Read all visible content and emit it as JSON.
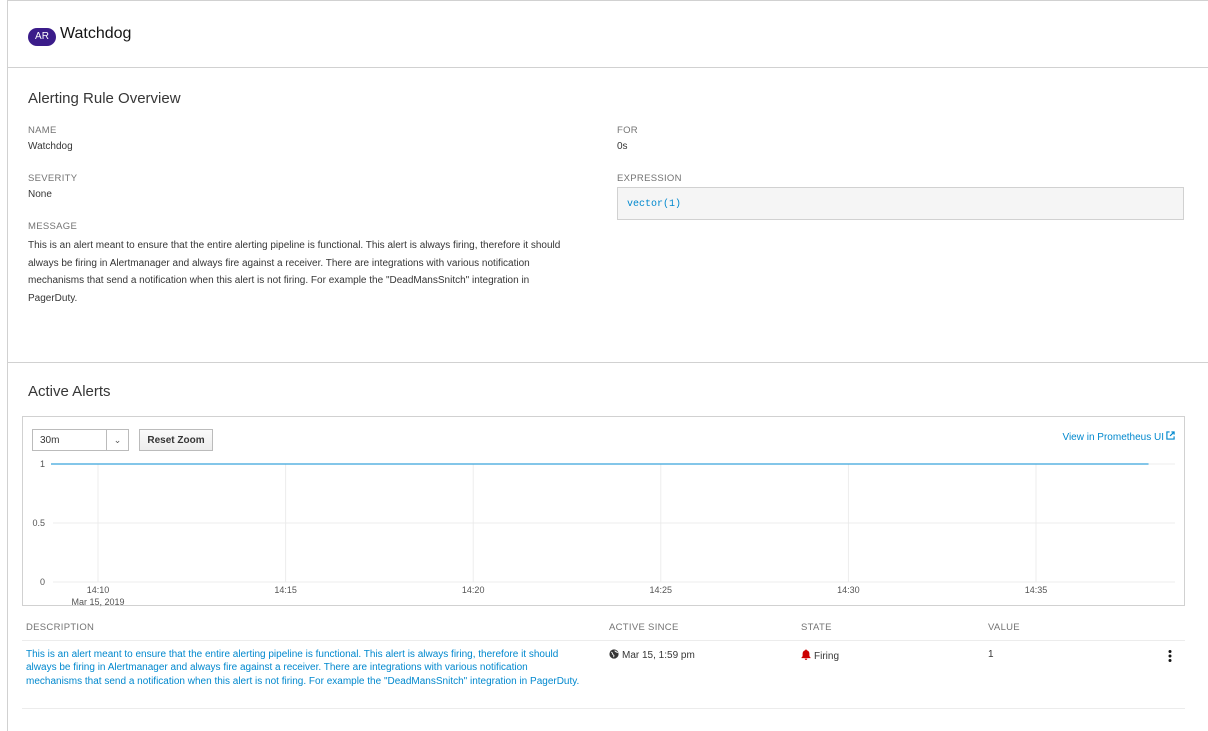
{
  "header": {
    "badge": "AR",
    "title": "Watchdog"
  },
  "overview": {
    "title": "Alerting Rule Overview",
    "name_label": "NAME",
    "name_value": "Watchdog",
    "severity_label": "SEVERITY",
    "severity_value": "None",
    "message_label": "MESSAGE",
    "message_value": "This is an alert meant to ensure that the entire alerting pipeline is functional. This alert is always firing, therefore it should always be firing in Alertmanager and always fire against a receiver. There are integrations with various notification mechanisms that send a notification when this alert is not firing. For example the \"DeadMansSnitch\" integration in PagerDuty.",
    "for_label": "FOR",
    "for_value": "0s",
    "expression_label": "EXPRESSION",
    "expression_value": "vector(1)"
  },
  "active_alerts": {
    "title": "Active Alerts",
    "range_value": "30m",
    "reset_zoom_label": "Reset Zoom",
    "prometheus_link_label": "View in Prometheus UI"
  },
  "chart_data": {
    "type": "line",
    "x_ticks": [
      "14:10",
      "14:15",
      "14:20",
      "14:25",
      "14:30",
      "14:35"
    ],
    "x_tick_sublabel": "Mar 15, 2019",
    "y_ticks": [
      "0",
      "0.5",
      "1"
    ],
    "ylim": [
      0,
      1
    ],
    "series": [
      {
        "x": [
          "14:10",
          "14:38"
        ],
        "values": [
          1,
          1
        ]
      }
    ],
    "grid": true,
    "line_color": "#39a5dc"
  },
  "table": {
    "columns": [
      "DESCRIPTION",
      "ACTIVE SINCE",
      "STATE",
      "VALUE"
    ],
    "rows": [
      {
        "description": "This is an alert meant to ensure that the entire alerting pipeline is functional. This alert is always firing, therefore it should always be firing in Alertmanager and always fire against a receiver. There are integrations with various notification mechanisms that send a notification when this alert is not firing. For example the \"DeadMansSnitch\" integration in PagerDuty.",
        "active_since": "Mar 15, 1:59 pm",
        "state": "Firing",
        "value": "1",
        "state_icon": "bell-icon",
        "since_icon": "globe-icon"
      }
    ]
  },
  "colors": {
    "badge": "#3b1c8a",
    "link": "#0088ce",
    "firing": "#cc0000"
  }
}
